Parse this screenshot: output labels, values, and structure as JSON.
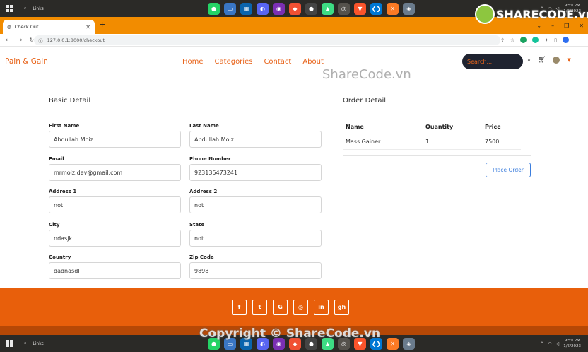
{
  "taskbar": {
    "search_label": "Links",
    "clock_time": "9:59 PM",
    "clock_date": "1/5/2023",
    "apps": [
      "whatsapp-icon",
      "terminal-icon",
      "store-icon",
      "discord-icon",
      "obs-icon",
      "git-icon",
      "github-icon",
      "android-icon",
      "browser-icon",
      "brave-icon",
      "vscode-icon",
      "xampp-icon",
      "other-icon"
    ]
  },
  "browser": {
    "tab_title": "Check Out",
    "url": "127.0.0.1:8000/checkout"
  },
  "navbar": {
    "brand": "Pain & Gain",
    "links": [
      "Home",
      "Categories",
      "Contact",
      "About"
    ],
    "search_placeholder": "Search..."
  },
  "basic_detail": {
    "title": "Basic Detail",
    "fields": {
      "first_name": {
        "label": "First Name",
        "value": "Abdullah Moiz"
      },
      "last_name": {
        "label": "Last Name",
        "value": "Abdullah Moiz"
      },
      "email": {
        "label": "Email",
        "value": "mrmoiz.dev@gmail.com"
      },
      "phone": {
        "label": "Phone Number",
        "value": "923135473241"
      },
      "address1": {
        "label": "Address 1",
        "value": "not"
      },
      "address2": {
        "label": "Address 2",
        "value": "not"
      },
      "city": {
        "label": "City",
        "value": "ndasjk"
      },
      "state": {
        "label": "State",
        "value": "not"
      },
      "country": {
        "label": "Country",
        "value": "dadnasdl"
      },
      "zip": {
        "label": "Zip Code",
        "value": "9898"
      }
    }
  },
  "order_detail": {
    "title": "Order Detail",
    "columns": [
      "Name",
      "Quantity",
      "Price"
    ],
    "rows": [
      [
        "Mass Gainer",
        "1",
        "7500"
      ]
    ],
    "place_order": "Place Order"
  },
  "footer": {
    "social": [
      "f",
      "t",
      "G",
      "◎",
      "in",
      "gh"
    ]
  },
  "watermarks": {
    "center": "ShareCode.vn",
    "copyright": "Copyright © ShareCode.vn",
    "logo": "SHARECODE.vn"
  },
  "colors": {
    "accent": "#e8641b",
    "footer": "#e85f0b",
    "tabstrip": "#f28c00",
    "button": "#3b7ddd"
  }
}
